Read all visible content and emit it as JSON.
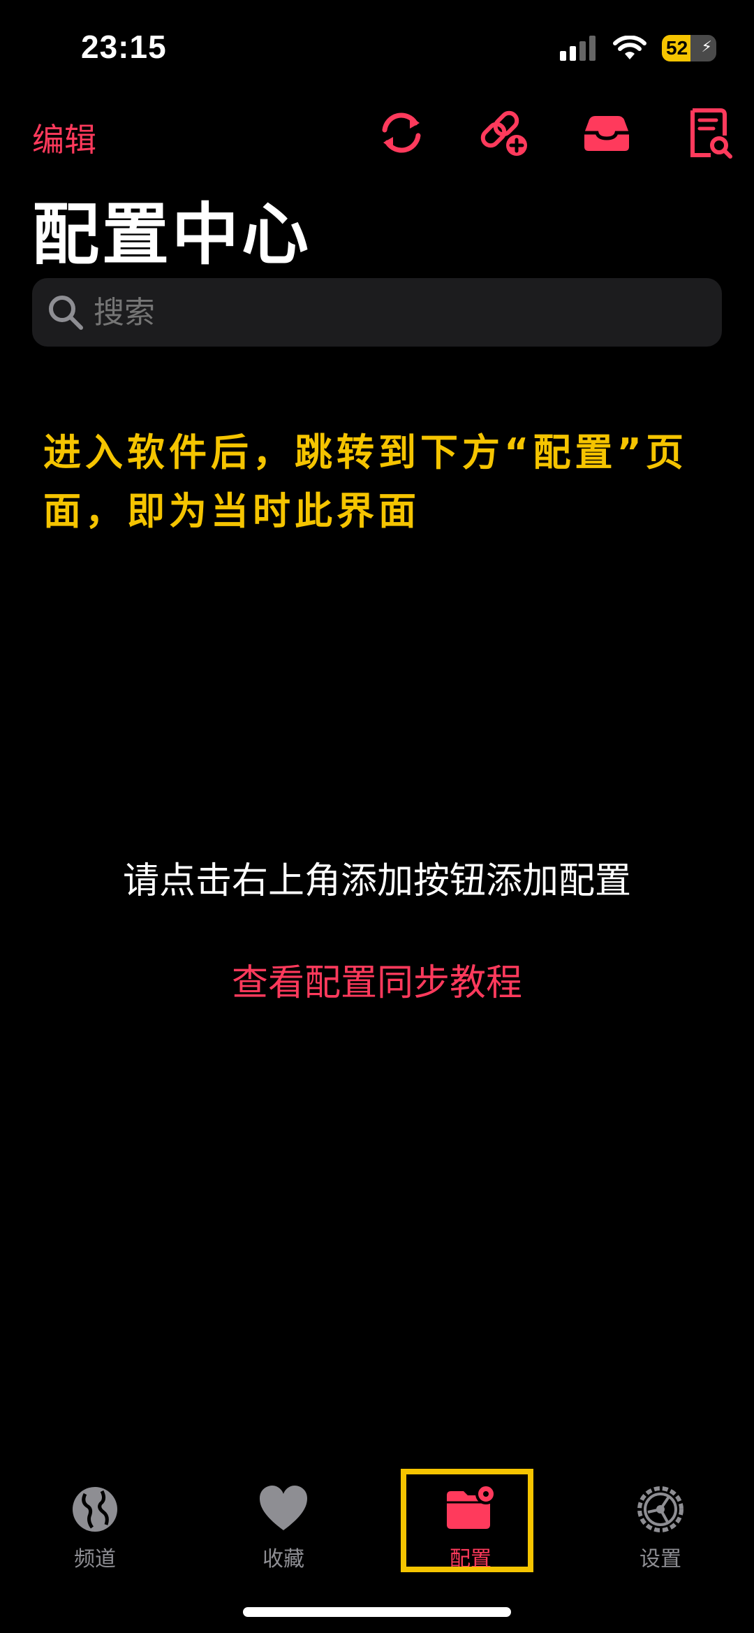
{
  "status_bar": {
    "time": "23:15",
    "battery": "52"
  },
  "nav": {
    "edit_label": "编辑"
  },
  "page": {
    "title": "配置中心"
  },
  "search": {
    "placeholder": "搜索"
  },
  "annotation": {
    "text": "进入软件后，跳转到下方“配置”页面，即为当时此界面"
  },
  "empty_state": {
    "message": "请点击右上角添加按钮添加配置",
    "tutorial_link": "查看配置同步教程"
  },
  "tab_bar": {
    "items": [
      {
        "label": "频道",
        "icon": "globe-icon"
      },
      {
        "label": "收藏",
        "icon": "heart-icon"
      },
      {
        "label": "配置",
        "icon": "folder-gear-icon",
        "active": true
      },
      {
        "label": "设置",
        "icon": "gear-icon"
      }
    ]
  },
  "colors": {
    "accent": "#ff3a5c",
    "annotation": "#f5c400",
    "background": "#000000"
  }
}
